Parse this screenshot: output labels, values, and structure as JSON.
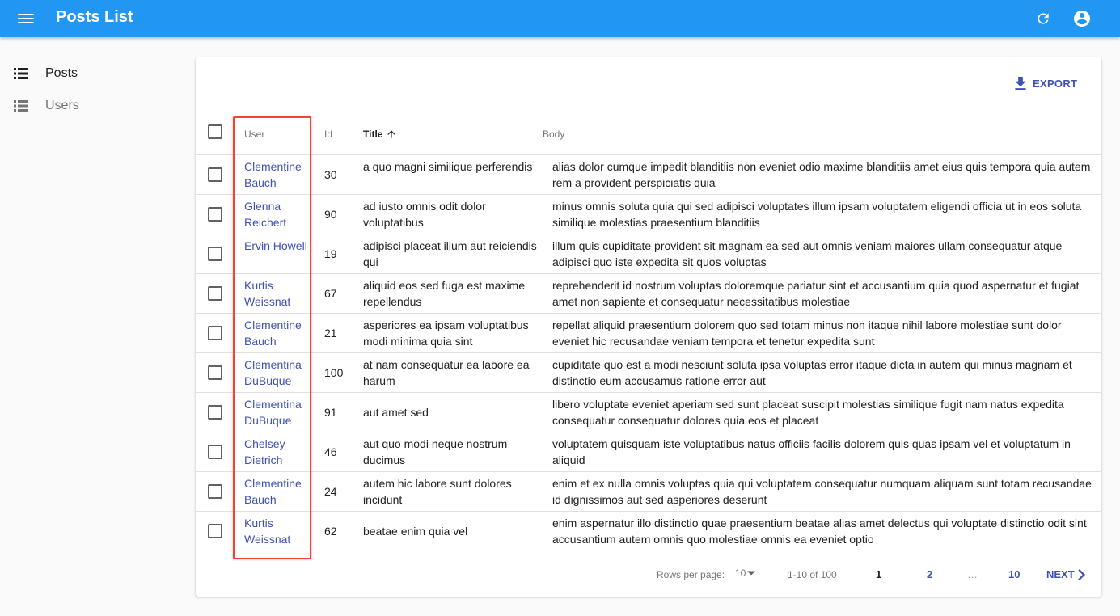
{
  "appbar": {
    "title": "Posts List",
    "color": "#2196f3",
    "icons": [
      "menu-icon",
      "refresh-icon",
      "account-circle-icon"
    ]
  },
  "sidebar": {
    "items": [
      {
        "label": "Posts",
        "icon": "list-icon",
        "active": true
      },
      {
        "label": "Users",
        "icon": "list-icon",
        "active": false
      }
    ]
  },
  "toolbar": {
    "export_label": "EXPORT",
    "export_icon": "download-icon"
  },
  "table": {
    "columns": {
      "user": "User",
      "id": "Id",
      "title": "Title",
      "body": "Body"
    },
    "sort": {
      "column": "Title",
      "direction": "asc"
    },
    "rows": [
      {
        "user": "Clementine Bauch",
        "id": "30",
        "title": "a quo magni similique perferendis",
        "body": "alias dolor cumque impedit blanditiis non eveniet odio maxime blanditiis amet eius quis tempora quia autem rem a provident perspiciatis quia"
      },
      {
        "user": "Glenna Reichert",
        "id": "90",
        "title": "ad iusto omnis odit dolor voluptatibus",
        "body": "minus omnis soluta quia qui sed adipisci voluptates illum ipsam voluptatem eligendi officia ut in eos soluta similique molestias praesentium blanditiis"
      },
      {
        "user": "Ervin Howell",
        "id": "19",
        "title": "adipisci placeat illum aut reiciendis qui",
        "body": "illum quis cupiditate provident sit magnam ea sed aut omnis veniam maiores ullam consequatur atque adipisci quo iste expedita sit quos voluptas"
      },
      {
        "user": "Kurtis Weissnat",
        "id": "67",
        "title": "aliquid eos sed fuga est maxime repellendus",
        "body": "reprehenderit id nostrum voluptas doloremque pariatur sint et accusantium quia quod aspernatur et fugiat amet non sapiente et consequatur necessitatibus molestiae"
      },
      {
        "user": "Clementine Bauch",
        "id": "21",
        "title": "asperiores ea ipsam voluptatibus modi minima quia sint",
        "body": "repellat aliquid praesentium dolorem quo sed totam minus non itaque nihil labore molestiae sunt dolor eveniet hic recusandae veniam tempora et tenetur expedita sunt"
      },
      {
        "user": "Clementina DuBuque",
        "id": "100",
        "title": "at nam consequatur ea labore ea harum",
        "body": "cupiditate quo est a modi nesciunt soluta ipsa voluptas error itaque dicta in autem qui minus magnam et distinctio eum accusamus ratione error aut"
      },
      {
        "user": "Clementina DuBuque",
        "id": "91",
        "title": "aut amet sed",
        "body": "libero voluptate eveniet aperiam sed sunt placeat suscipit molestias similique fugit nam natus expedita consequatur consequatur dolores quia eos et placeat"
      },
      {
        "user": "Chelsey Dietrich",
        "id": "46",
        "title": "aut quo modi neque nostrum ducimus",
        "body": "voluptatem quisquam iste voluptatibus natus officiis facilis dolorem quis quas ipsam vel et voluptatum in aliquid"
      },
      {
        "user": "Clementine Bauch",
        "id": "24",
        "title": "autem hic labore sunt dolores incidunt",
        "body": "enim et ex nulla omnis voluptas quia qui voluptatem consequatur numquam aliquam sunt totam recusandae id dignissimos aut sed asperiores deserunt"
      },
      {
        "user": "Kurtis Weissnat",
        "id": "62",
        "title": "beatae enim quia vel",
        "body": "enim aspernatur illo distinctio quae praesentium beatae alias amet delectus qui voluptate distinctio odit sint accusantium autem omnis quo molestiae omnis ea eveniet optio"
      }
    ]
  },
  "pagination": {
    "rows_per_page_label": "Rows per page:",
    "rows_per_page": "10",
    "range": "1-10 of 100",
    "pages": [
      "1",
      "2",
      "…",
      "10"
    ],
    "current_page": "1",
    "next_label": "NEXT"
  },
  "accent_color": "#3f51b5",
  "highlight_color": "#f44336"
}
